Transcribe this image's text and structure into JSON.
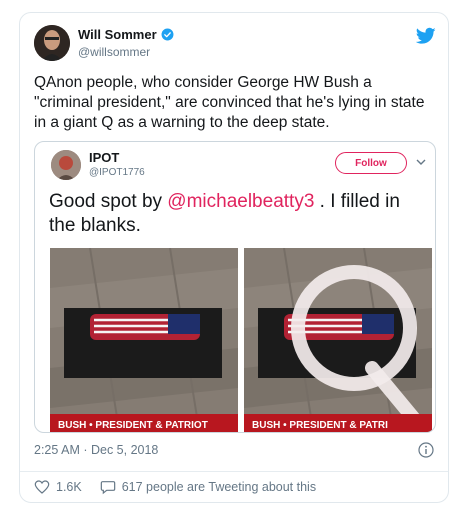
{
  "tweet": {
    "author_name": "Will Sommer",
    "author_handle": "@willsommer",
    "text": "QAnon people, who consider George HW Bush a \"criminal president,\" are convinced that he's lying in state in a giant Q as a warning to the deep state.",
    "timestamp": "2:25 AM · Dec 5, 2018",
    "likes": "1.6K",
    "tweeting_about": "617 people are Tweeting about this"
  },
  "quoted": {
    "author_name": "IPOT",
    "author_handle": "@IPOT1776",
    "follow_label": "Follow",
    "text_before": "Good spot by ",
    "mention": "@michaelbeatty3",
    "text_after": " . I filled in the blanks.",
    "media": {
      "left_banner": "BUSH • PRESIDENT & PATRIOT",
      "right_banner": "BUSH • PRESIDENT & PATRI"
    }
  },
  "colors": {
    "twitter_blue": "#1da1f2",
    "follow_red": "#e0245e",
    "banner_red": "#b8171f"
  }
}
